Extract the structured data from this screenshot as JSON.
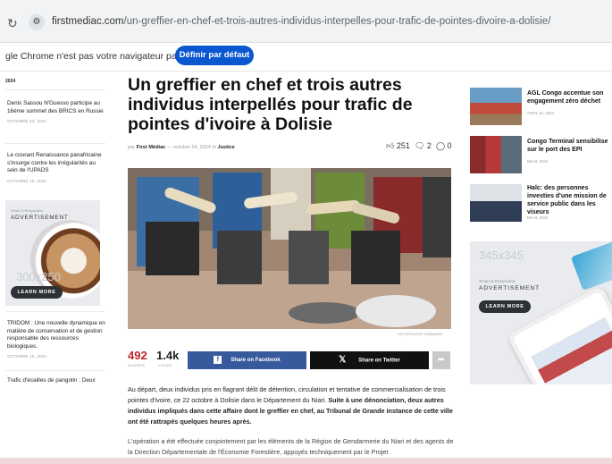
{
  "browser": {
    "url_host": "firstmediac.com",
    "url_path": "/un-greffier-en-chef-et-trois-autres-individus-interpelles-pour-trafic-de-pointes-divoire-a-dolisie/",
    "infobar_message": "gle Chrome n'est pas votre navigateur par défaut",
    "infobar_button": "Définir par défaut"
  },
  "left_sidebar": {
    "top_date": "2024",
    "items": [
      {
        "title": "Denis Sassou N'Guesso participe au 16ème sommet des BRICS en Russie",
        "date": "OCTOBRE 24, 2024"
      },
      {
        "title": "Le courant Renaissance panafricaine s'insurge contre les irrégularités au sein de l'UPADS",
        "date": "OCTOBRE 10, 2024"
      },
      {
        "title": "TRIDOM : Une nouvelle dynamique en matière de conservation et de gestion responsable des ressources biologiques.",
        "date": "OCTOBRE 10, 2024"
      },
      {
        "title": "Trafic d'écailles de pangolin : Deux",
        "date": ""
      }
    ],
    "ad": {
      "small": "Smart & Responsive",
      "label": "ADVERTISEMENT",
      "size": "300x250",
      "button": "LEARN MORE"
    }
  },
  "article": {
    "title": "Un greffier en chef et trois autres individus interpellés pour trafic de pointes d'ivoire à Dolisie",
    "meta_prefix": "par",
    "author": "First Médiac",
    "date": "octobre 24, 2024",
    "meta_in": "in",
    "category": "Justice",
    "likes": "251",
    "comments": "2",
    "views_icon_count": "0",
    "caption": "Les présumés trafiquants",
    "shares": "492",
    "shares_label": "SHARES",
    "views": "1.4k",
    "views_label": "VIEWS",
    "share_facebook": "Share on Facebook",
    "share_twitter": "Share on Twitter",
    "paragraph1_normal": "Au départ, deux individus pris en flagrant délit de détention, circulation et tentative de commercialisation de trois pointes d'ivoire, ce 22 octobre à Dolisie dans le Département du Niari. ",
    "paragraph1_bold": "Suite à une dénonciation, deux autres individus impliqués dans cette affaire dont le greffier en chef, au Tribunal de Grande instance de cette ville ont été rattrapés quelques heures après.",
    "paragraph2": "L'opération a été effectuée conjointement par les éléments de la Région de Gendarmerie du Niari et des agents de la Direction Départementale de l'Économie Forestière, appuyés techniquement par le Projet"
  },
  "right_sidebar": {
    "items": [
      {
        "title": "AGL Congo accentue son engagement zéro déchet",
        "date": "AVRIL 10, 2024"
      },
      {
        "title": "Congo Terminal sensibilise sur le port des EPI",
        "date": "MAI 8, 2024"
      },
      {
        "title": "Halc: des personnes investies d'une mission de service public dans les viseurs",
        "date": "MAI 8, 2024"
      }
    ],
    "ad": {
      "size": "345x345",
      "small": "Smart & Responsive",
      "label": "ADVERTISEMENT",
      "button": "LEARN MORE"
    }
  },
  "colors": {
    "accent_red": "#c0262c",
    "facebook": "#375a9c",
    "twitter": "#111111",
    "chrome_blue": "#0b57d0"
  }
}
